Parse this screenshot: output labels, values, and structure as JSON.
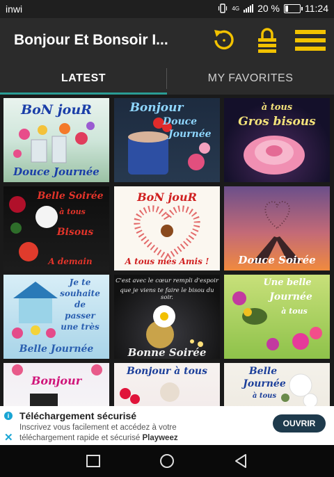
{
  "status": {
    "carrier": "inwi",
    "network": "4G",
    "battery": "20 %",
    "time": "11:24",
    "battery_level": 0.2
  },
  "app": {
    "title": "Bonjour Et Bonsoir I...",
    "icons": [
      "refresh-icon",
      "lock-icon",
      "menu-icon"
    ],
    "accent": "#f2c200"
  },
  "tabs": [
    {
      "label": "LATEST",
      "active": true
    },
    {
      "label": "MY FAVORITES",
      "active": false
    }
  ],
  "tiles": [
    {
      "top": "BoN jouR",
      "bottom": "Douce Journée"
    },
    {
      "top": "Bonjour",
      "top2": "Douce",
      "top3": "Journée"
    },
    {
      "top": "à tous",
      "top2": "Gros bisous"
    },
    {
      "top": "Belle Soirée",
      "top2": "à tous",
      "top3": "Bisous",
      "bottom": "A demain"
    },
    {
      "top": "BoN jouR",
      "bottom": "A tous mes Amis !"
    },
    {
      "top": "",
      "bottom": "Douce Soirée"
    },
    {
      "top": "Je te",
      "top2": "souhaite",
      "top3": "de",
      "top4": "passer",
      "top5": "une très",
      "bottom": "Belle Journée"
    },
    {
      "top": "C'est avec le cœur rempli d'espoir",
      "top2": "que je viens te faire le bisou du soir.",
      "bottom": "Bonne Soirée"
    },
    {
      "top": "Une belle",
      "top2": "Journée",
      "top3": "à tous"
    },
    {
      "top": "Bonjour"
    },
    {
      "top": "Bonjour à tous"
    },
    {
      "top": "Belle",
      "top2": "Journée",
      "top3": "à tous"
    }
  ],
  "ad": {
    "title": "Téléchargement sécurisé",
    "line1": "Inscrivez vous facilement et accédez à votre",
    "line2": "téléchargement rapide et sécurisé",
    "brand": "Playweez",
    "button": "OUVRIR",
    "info": "i",
    "close": "✕"
  },
  "nav": {
    "icons": [
      "recent-apps-icon",
      "home-icon",
      "back-icon"
    ]
  }
}
